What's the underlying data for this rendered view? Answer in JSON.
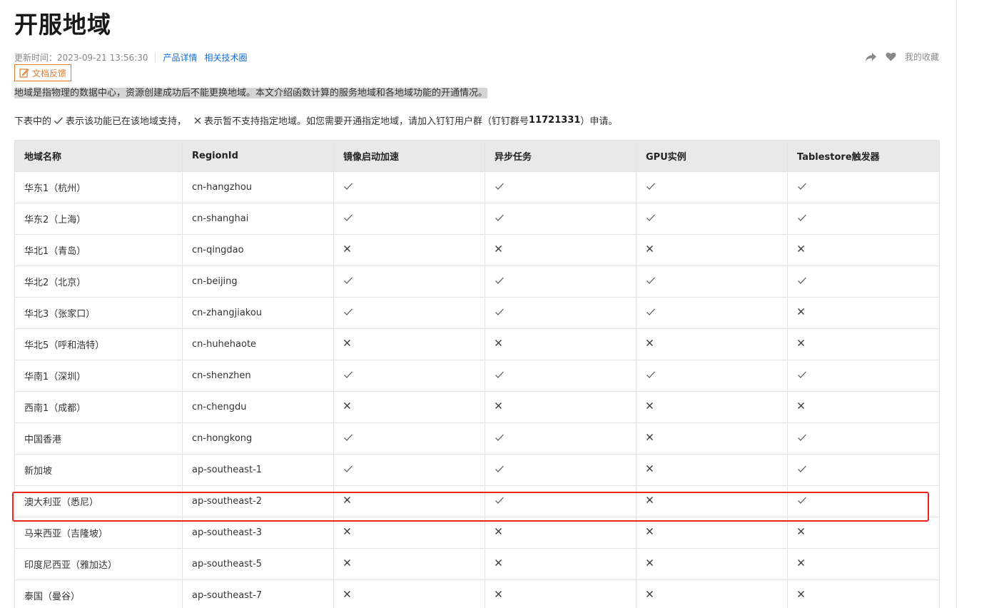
{
  "page": {
    "title": "开服地域",
    "updated_label": "更新时间：",
    "updated_value": "2023-09-21 13:56:30",
    "links": [
      "产品详情",
      "相关技术圈"
    ],
    "favorite_label": "我的收藏",
    "feedback_label": "文档反馈"
  },
  "intro": {
    "text": "地域是指物理的数据中心，资源创建成功后不能更换地域。本文介绍函数计算的服务地域和各地域功能的开通情况。"
  },
  "note": {
    "part1": "下表中的",
    "part2": "表示该功能已在该地域支持，",
    "part3": "表示暂不支持指定地域。如您需要开通指定地域，请加入钉钉用户群（钉钉群号",
    "group_number": "11721331",
    "part4": "）申请。"
  },
  "table": {
    "headers": [
      "地域名称",
      "RegionId",
      "镜像启动加速",
      "异步任务",
      "GPU实例",
      "Tablestore触发器"
    ],
    "rows": [
      {
        "name": "华东1（杭州）",
        "id": "cn-hangzhou",
        "f": [
          true,
          true,
          true,
          true
        ]
      },
      {
        "name": "华东2（上海）",
        "id": "cn-shanghai",
        "f": [
          true,
          true,
          true,
          true
        ]
      },
      {
        "name": "华北1（青岛）",
        "id": "cn-qingdao",
        "f": [
          false,
          false,
          false,
          false
        ]
      },
      {
        "name": "华北2（北京）",
        "id": "cn-beijing",
        "f": [
          true,
          true,
          true,
          true
        ]
      },
      {
        "name": "华北3（张家口）",
        "id": "cn-zhangjiakou",
        "f": [
          true,
          true,
          true,
          false
        ]
      },
      {
        "name": "华北5（呼和浩特）",
        "id": "cn-huhehaote",
        "f": [
          false,
          false,
          false,
          false
        ]
      },
      {
        "name": "华南1（深圳）",
        "id": "cn-shenzhen",
        "f": [
          true,
          true,
          true,
          true
        ]
      },
      {
        "name": "西南1（成都）",
        "id": "cn-chengdu",
        "f": [
          false,
          false,
          false,
          false
        ]
      },
      {
        "name": "中国香港",
        "id": "cn-hongkong",
        "f": [
          true,
          true,
          false,
          true
        ]
      },
      {
        "name": "新加坡",
        "id": "ap-southeast-1",
        "f": [
          true,
          true,
          false,
          true
        ]
      },
      {
        "name": "澳大利亚（悉尼）",
        "id": "ap-southeast-2",
        "f": [
          false,
          true,
          false,
          true
        ]
      },
      {
        "name": "马来西亚（吉隆坡）",
        "id": "ap-southeast-3",
        "f": [
          false,
          false,
          false,
          false
        ]
      },
      {
        "name": "印度尼西亚（雅加达）",
        "id": "ap-southeast-5",
        "f": [
          false,
          false,
          false,
          false
        ]
      },
      {
        "name": "泰国（曼谷）",
        "id": "ap-southeast-7",
        "f": [
          false,
          false,
          false,
          false
        ]
      }
    ],
    "highlighted_region": "ap-southeast-2"
  },
  "colors": {
    "link": "#1a6ed8",
    "feedback": "#e07a2f",
    "highlight_border": "#e8261d",
    "header_bg": "#e9e9e9"
  }
}
